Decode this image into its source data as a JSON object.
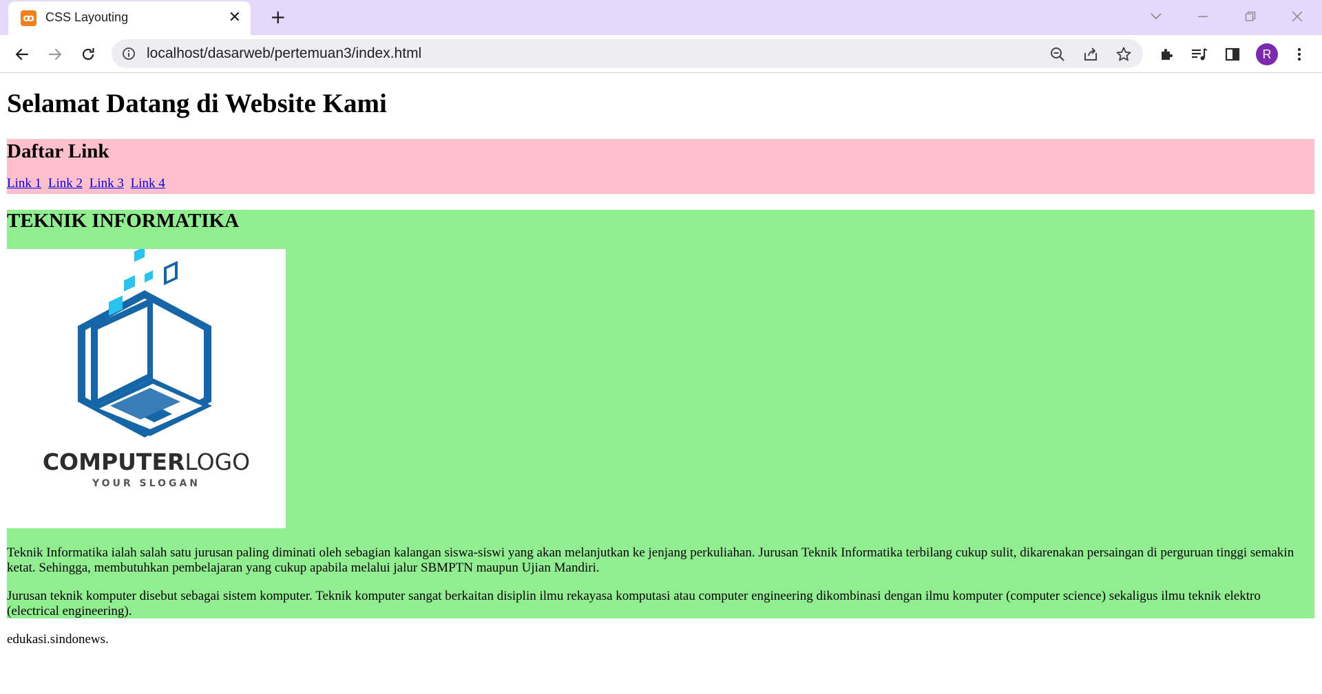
{
  "browser": {
    "tab_title": "CSS Layouting",
    "tab_close": "✕",
    "new_tab": "+",
    "url": "localhost/dasarweb/pertemuan3/index.html",
    "profile_initial": "R",
    "colors": {
      "tabstrip": "#e4d9fb",
      "avatar": "#7b2ab0"
    }
  },
  "page": {
    "heading": "Selamat Datang di Website Kami",
    "links_section": {
      "heading": "Daftar Link",
      "links": [
        "Link 1",
        "Link 2",
        "Link 3",
        "Link 4"
      ],
      "background": "#ffc0cb"
    },
    "ti_section": {
      "heading": "TEKNIK INFORMATIKA",
      "background": "#90ee90",
      "logo": {
        "word_bold": "COMPUTER",
        "word_light": "LOGO",
        "slogan": "YOUR SLOGAN"
      },
      "paragraphs": [
        "Teknik Informatika ialah salah satu jurusan paling diminati oleh sebagian kalangan siswa-siswi yang akan melanjutkan ke jenjang perkuliahan. Jurusan Teknik Informatika terbilang cukup sulit, dikarenakan persaingan di perguruan tinggi semakin ketat. Sehingga, membutuhkan pembelajaran yang cukup apabila melalui jalur SBMPTN maupun Ujian Mandiri.",
        "Jurusan teknik komputer disebut sebagai sistem komputer. Teknik komputer sangat berkaitan disiplin ilmu rekayasa komputasi atau computer engineering dikombinasi dengan ilmu komputer (computer science) sekaligus ilmu teknik elektro (electrical engineering)."
      ]
    },
    "source": "edukasi.sindonews."
  }
}
